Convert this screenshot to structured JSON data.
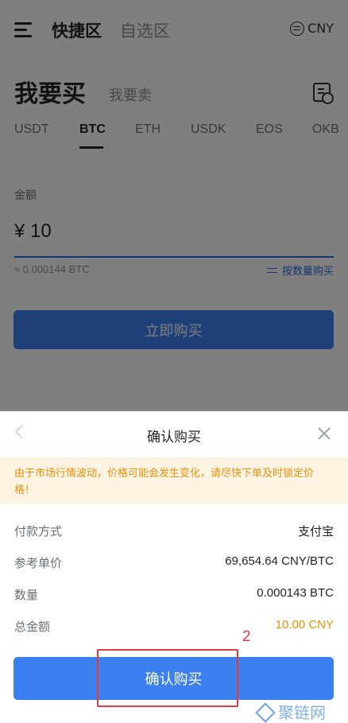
{
  "header": {
    "tab_quick": "快捷区",
    "tab_self": "自选区",
    "currency": "CNY"
  },
  "trade": {
    "buy_title": "我要买",
    "sell_title": "我要卖"
  },
  "coins": [
    "USDT",
    "BTC",
    "ETH",
    "USDK",
    "EOS",
    "OKB"
  ],
  "active_coin": "BTC",
  "amount": {
    "label": "金额",
    "value": "¥ 10",
    "approx": "≈ 0.000144 BTC",
    "switch_label": "按数量购买"
  },
  "buy_now_label": "立即购买",
  "sheet": {
    "title": "确认购买",
    "warning": "由于市场行情波动，价格可能会发生变化，请尽快下单及时锁定价格！",
    "rows": [
      {
        "label": "付款方式",
        "value": "支付宝"
      },
      {
        "label": "参考单价",
        "value": "69,654.64 CNY/BTC"
      },
      {
        "label": "数量",
        "value": "0.000143 BTC"
      },
      {
        "label": "总金额",
        "value": "10.00 CNY"
      }
    ],
    "confirm_label": "确认购买"
  },
  "annotation": {
    "step": "2"
  },
  "watermark": "聚链网",
  "colors": {
    "primary": "#3c7ff0",
    "warning": "#e8910c",
    "highlight": "#e33b3b"
  }
}
